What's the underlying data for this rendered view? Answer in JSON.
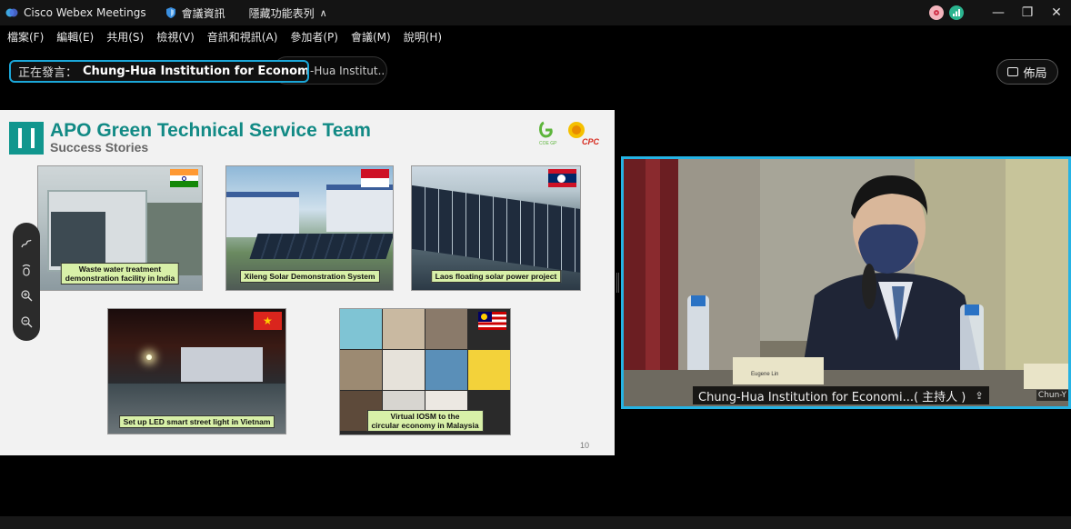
{
  "window": {
    "app_title": "Cisco Webex Meetings",
    "meeting_info": "會議資訊",
    "hide_menu": "隱藏功能表列"
  },
  "menu": {
    "items": [
      "檔案(F)",
      "編輯(E)",
      "共用(S)",
      "檢視(V)",
      "音訊和視訊(A)",
      "參加者(P)",
      "會議(M)",
      "說明(H)"
    ]
  },
  "speaker": {
    "label": "正在發言：",
    "name": "Chung-Hua Institution for Economic Re...",
    "second": "-Hua Institut..."
  },
  "layout_button": {
    "label": "佈局"
  },
  "slide": {
    "title": "APO Green Technical Service Team",
    "subtitle": "Success Stories",
    "logo_left_text": "COE GP",
    "logo_right_text": "CPC",
    "captions": {
      "india": "Waste water treatment\ndemonstration facility in India",
      "indonesia": "Xileng Solar Demonstration System",
      "laos": "Laos floating solar power project",
      "vietnam": "Set up LED smart street light in Vietnam",
      "malaysia": "Virtual IOSM to the\ncircular economy in Malaysia"
    },
    "page_number": "10"
  },
  "video": {
    "name_label": "Chung-Hua Institution for Economi...( 主持人 )",
    "second_name": "Chun-Y",
    "placard": "Eugene Lin"
  },
  "colors": {
    "accent": "#25b3e4",
    "slide_teal": "#128a85",
    "caption_bg": "#d8f0a8"
  }
}
